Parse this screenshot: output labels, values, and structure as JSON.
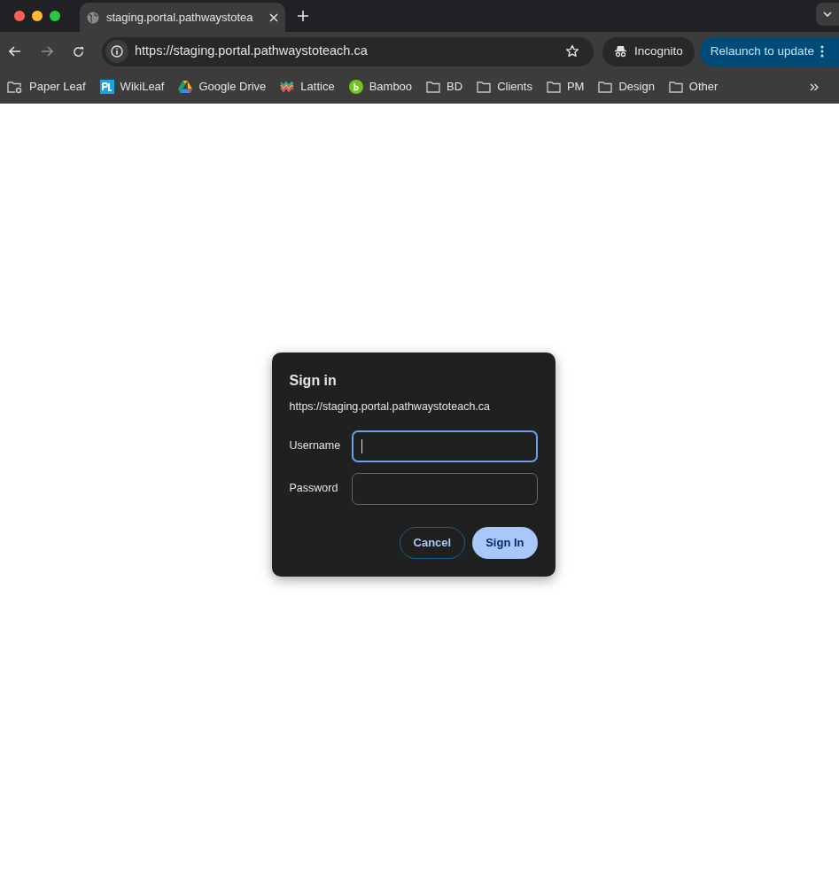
{
  "tab": {
    "title": "staging.portal.pathwaystotea",
    "selected": true
  },
  "address_bar": {
    "url": "https://staging.portal.pathwaystoteach.ca"
  },
  "incognito": {
    "label": "Incognito"
  },
  "update_button": {
    "label": "Relaunch to update"
  },
  "bookmarks": [
    {
      "kind": "managed",
      "label": "Paper Leaf"
    },
    {
      "kind": "pl",
      "label": "WikiLeaf"
    },
    {
      "kind": "drive",
      "label": "Google Drive"
    },
    {
      "kind": "lattice",
      "label": "Lattice"
    },
    {
      "kind": "bamboo",
      "label": "Bamboo"
    },
    {
      "kind": "folder",
      "label": "BD"
    },
    {
      "kind": "folder",
      "label": "Clients"
    },
    {
      "kind": "folder",
      "label": "PM"
    },
    {
      "kind": "folder",
      "label": "Design"
    },
    {
      "kind": "folder",
      "label": "Other"
    }
  ],
  "dialog": {
    "title": "Sign in",
    "origin": "https://staging.portal.pathwaystoteach.ca",
    "fields": [
      {
        "label": "Username",
        "focused": true
      },
      {
        "label": "Password",
        "focused": false
      }
    ],
    "buttons": [
      {
        "label": "Cancel",
        "kind": "secondary"
      },
      {
        "label": "Sign In",
        "kind": "primary"
      }
    ]
  }
}
